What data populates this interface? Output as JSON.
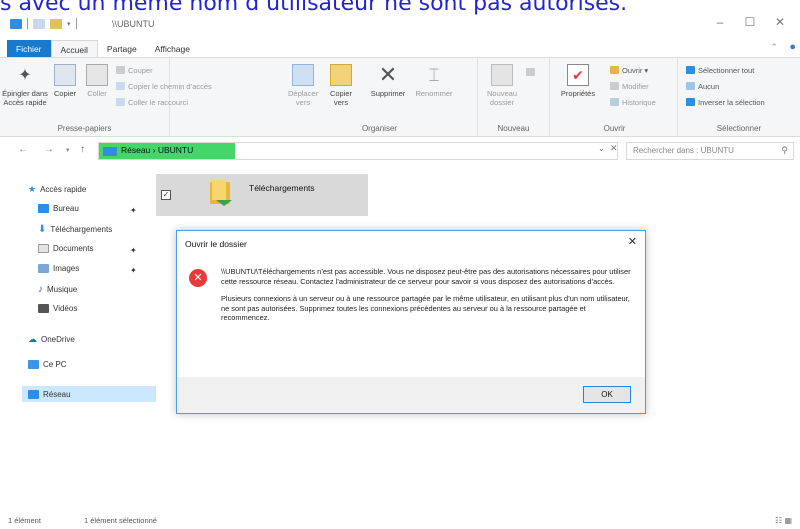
{
  "overlay_text": "s avec un même nom d’utilisateur ne sont pas autorisés.",
  "titlebar": {
    "title": "\\\\UBUNTU"
  },
  "tabs": [
    {
      "label": "Fichier"
    },
    {
      "label": "Accueil"
    },
    {
      "label": "Partage"
    },
    {
      "label": "Affichage"
    }
  ],
  "ribbon": {
    "pin_label": "Épingler dans Accès rapide",
    "copy_label": "Copier",
    "paste_label": "Coller",
    "cut_label": "Couper",
    "copy_path_label": "Copier le chemin d’accès",
    "paste_shortcut_label": "Coller le raccourci",
    "clipboard_group": "Presse-papiers",
    "move_to_label": "Déplacer vers",
    "copy_to_label": "Copier vers",
    "delete_label": "Supprimer",
    "rename_label": "Renommer",
    "organize_group": "Organiser",
    "new_folder_label": "Nouveau dossier",
    "new_group": "Nouveau",
    "properties_label": "Propriétés",
    "open_label": "Ouvrir",
    "edit_label": "Modifier",
    "history_label": "Historique",
    "open_group": "Ouvrir",
    "select_all_label": "Sélectionner tout",
    "select_none_label": "Aucun",
    "invert_label": "Inverser la sélection",
    "select_group": "Sélectionner"
  },
  "address": {
    "path": "Réseau  ›  UBUNTU"
  },
  "search": {
    "placeholder": "Rechercher dans : UBUNTU"
  },
  "nav": {
    "quick_access": "Accès rapide",
    "desktop": "Bureau",
    "downloads": "Téléchargements",
    "documents": "Documents",
    "images": "Images",
    "music": "Musique",
    "videos": "Vidéos",
    "onedrive": "OneDrive",
    "this_pc": "Ce PC",
    "network": "Réseau"
  },
  "files": [
    {
      "name": "Téléchargements"
    }
  ],
  "dialog": {
    "title": "Ouvrir le dossier",
    "paragraph1": "\\\\UBUNTU\\Téléchargements n’est pas accessible. Vous ne disposez peut-être pas des autorisations nécessaires pour utiliser cette ressource réseau. Contactez l’administrateur de ce serveur pour savoir si vous disposez des autorisations d’accès.",
    "paragraph2": "Plusieurs connexions à un serveur ou à une ressource partagée par le même utilisateur, en utilisant plus d’un nom utilisateur, ne sont pas autorisées. Supprimez toutes les connexions précédentes au serveur ou à la ressource partagée et recommencez.",
    "ok_label": "OK"
  },
  "status": {
    "count": "1 élément",
    "selected": "1 élément sélectionné"
  },
  "colors": {
    "accent": "#1979ca",
    "address_highlight": "#45d66b",
    "error": "#e63b3b",
    "overlay_text": "#2323d6"
  }
}
